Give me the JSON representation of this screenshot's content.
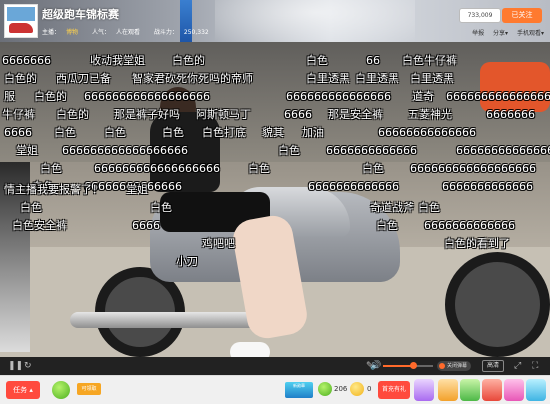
{
  "header": {
    "room_title": "超级跑车锦标赛",
    "anchor_label": "主播：",
    "anchor_name": "博物",
    "viewers_label": "人气：",
    "viewers_value": "",
    "category_label": "人在观看",
    "tag_label": "战斗力：",
    "tag_value": "250,332",
    "fan_count": "733,009",
    "follow_label": "已关注",
    "actions": [
      "举报",
      "分享▾",
      "手机观看▾"
    ]
  },
  "danmaku": [
    "6666666",
    "收动我堂姐",
    "白色的",
    "白色",
    "66",
    "白色牛仔裤",
    "白色的",
    "西瓜刀已备",
    "智家君砍死你死吗的帝师",
    "白里透黑",
    "白里透黑",
    "白里透黑",
    "服",
    "白色的",
    "666666666666666666",
    "666666666666666",
    "道奇",
    "666666666666666",
    "牛仔裤",
    "白色的",
    "那是裤子好吗",
    "阿斯顿马丁",
    "6666",
    "那是安全裤",
    "五菱神光",
    "6666666",
    "6666",
    "白色",
    "白色",
    "白色",
    "白色打底",
    "貌其",
    "加油",
    "66666666666666",
    "堂姐",
    "666666666666666666",
    "白色",
    "6666666666666",
    "66666666666666",
    "白色",
    "666666666666666666",
    "白色",
    "白色",
    "666666666666666666",
    "白色",
    "66666666666666",
    "6666666666666",
    "6666666666666",
    "情主播我要报警了！",
    "堂姐",
    "白色",
    "白色",
    "奇道战斧",
    "白色",
    "白色安全裤",
    "6666",
    "白色",
    "6666666666666",
    "白色的看到了",
    "鸡吧吧",
    "小刀"
  ],
  "controls": {
    "quality_label": "高清",
    "danmaku_toggle_label": "关闭弹幕",
    "volume_level": 0.6
  },
  "bottombar": {
    "task_label": "任务",
    "collect_label": "可领取",
    "badge_label": "新勋章",
    "fishball_count": "206",
    "coin_count": "0",
    "recharge_label": "首充有礼"
  },
  "colors": {
    "accent": "#ff7a2f",
    "task_red": "#ff4a3d"
  }
}
